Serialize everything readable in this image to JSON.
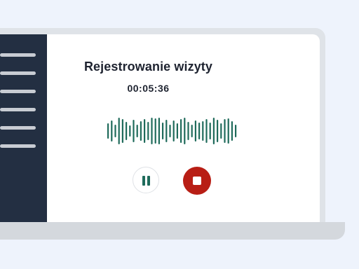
{
  "recording": {
    "title": "Rejestrowanie wizyty",
    "elapsed": "00:05:36"
  },
  "sidebar": {
    "item_count": 6,
    "line_color": "#c8ccd3",
    "background": "#232f42"
  },
  "controls": {
    "pause_icon": "pause-icon",
    "stop_icon": "stop-icon",
    "accent_color": "#1f6b5b",
    "stop_color": "#b81e15"
  },
  "waveform": {
    "color": "#1f6b5b",
    "levels": [
      0.55,
      0.75,
      0.45,
      0.95,
      0.85,
      0.65,
      0.4,
      0.8,
      0.45,
      0.7,
      0.85,
      0.65,
      0.95,
      0.9,
      0.95,
      0.6,
      0.8,
      0.45,
      0.75,
      0.55,
      0.85,
      0.95,
      0.65,
      0.45,
      0.75,
      0.6,
      0.7,
      0.85,
      0.6,
      0.95,
      0.8,
      0.55,
      0.85,
      0.9,
      0.7,
      0.45
    ]
  }
}
